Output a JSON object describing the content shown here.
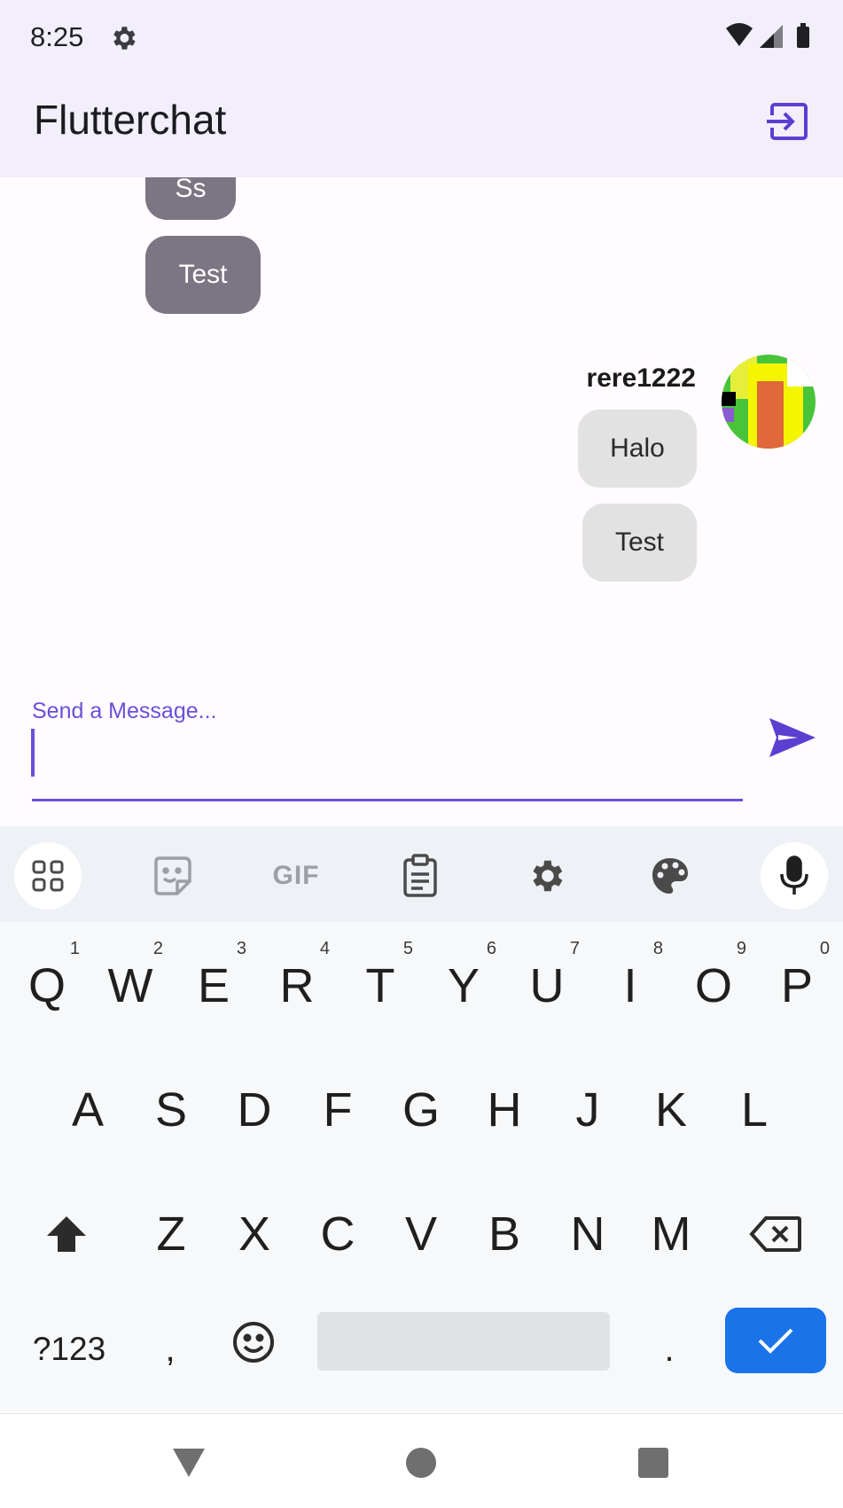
{
  "status_bar": {
    "time": "8:25",
    "icons": [
      "gear-icon",
      "wifi-icon",
      "signal-icon",
      "battery-icon"
    ]
  },
  "app_bar": {
    "title": "Flutterchat",
    "action_icon": "logout-icon"
  },
  "messages": {
    "other": [
      {
        "text": "Ss"
      },
      {
        "text": "Test"
      }
    ],
    "mine": {
      "username": "rere1222",
      "items": [
        {
          "text": "Halo"
        },
        {
          "text": "Test"
        }
      ]
    }
  },
  "input": {
    "label": "Send a Message...",
    "value": "",
    "send_icon": "send-icon"
  },
  "keyboard": {
    "toolbar_icons": [
      "apps-grid-icon",
      "sticker-icon",
      "gif-icon",
      "clipboard-icon",
      "settings-icon",
      "palette-icon",
      "mic-icon"
    ],
    "gif_label": "GIF",
    "row1": [
      {
        "key": "Q",
        "hint": "1"
      },
      {
        "key": "W",
        "hint": "2"
      },
      {
        "key": "E",
        "hint": "3"
      },
      {
        "key": "R",
        "hint": "4"
      },
      {
        "key": "T",
        "hint": "5"
      },
      {
        "key": "Y",
        "hint": "6"
      },
      {
        "key": "U",
        "hint": "7"
      },
      {
        "key": "I",
        "hint": "8"
      },
      {
        "key": "O",
        "hint": "9"
      },
      {
        "key": "P",
        "hint": "0"
      }
    ],
    "row2": [
      "A",
      "S",
      "D",
      "F",
      "G",
      "H",
      "J",
      "K",
      "L"
    ],
    "row3": [
      "Z",
      "X",
      "C",
      "V",
      "B",
      "N",
      "M"
    ],
    "symbols_key": "?123",
    "comma_key": ",",
    "period_key": "."
  },
  "colors": {
    "accent": "#6750d8",
    "enter": "#1a73e8",
    "app_bar": "#f2eefa",
    "other_bubble": "#7b7584",
    "mine_bubble": "#e2e2e2"
  }
}
